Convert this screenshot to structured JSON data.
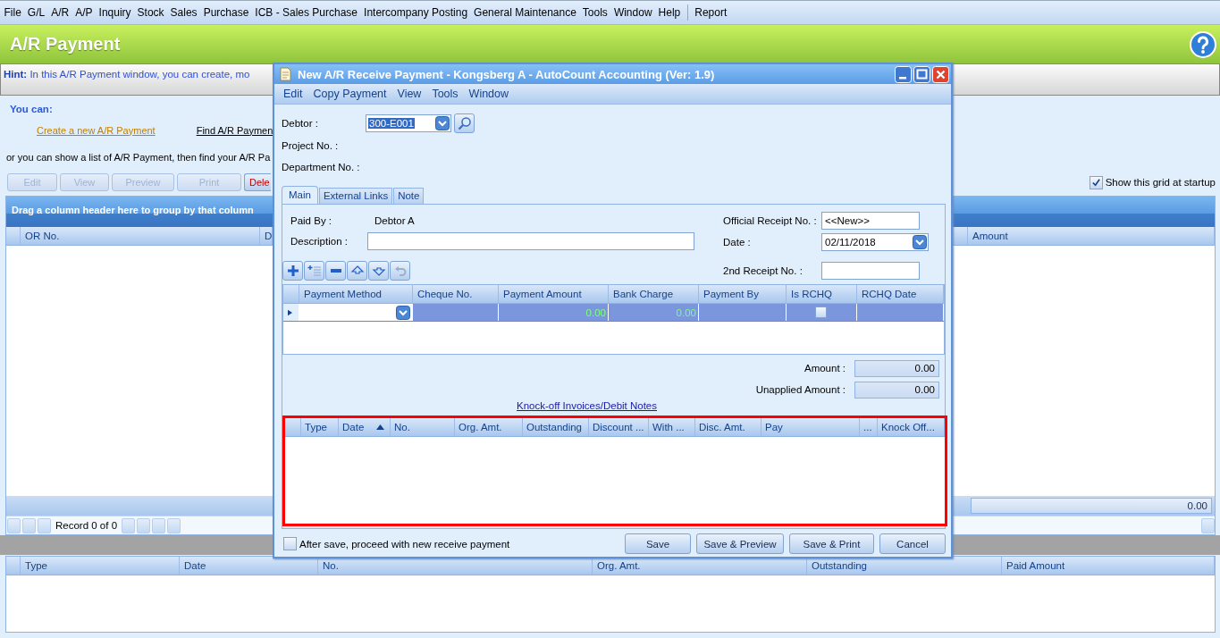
{
  "menu_bar": {
    "items": [
      "File",
      "G/L",
      "A/R",
      "A/P",
      "Inquiry",
      "Stock",
      "Sales",
      "Purchase",
      "ICB - Sales Purchase",
      "Intercompany Posting",
      "General Maintenance",
      "Tools",
      "Window",
      "Help"
    ],
    "extra_items": [
      "Report"
    ]
  },
  "page_header": {
    "title": "A/R Payment"
  },
  "hint": {
    "label": "Hint:",
    "text": "In this A/R Payment window, you can create, mo"
  },
  "actions": {
    "heading": "You can:",
    "links": [
      "Create a new A/R Payment",
      "Find A/R Paymen"
    ],
    "list_text": "or you can show a list of A/R Payment, then find your A/R Pa"
  },
  "toolbar": {
    "buttons": [
      {
        "label": "Edit",
        "disabled": true
      },
      {
        "label": "View",
        "disabled": true
      },
      {
        "label": "Preview",
        "disabled": true
      },
      {
        "label": "Print",
        "disabled": true
      },
      {
        "label": "Dele",
        "disabled": false
      }
    ]
  },
  "show_grid_checkbox": {
    "label": "Show this grid at startup",
    "checked": true
  },
  "list_grid": {
    "group_hint": "Drag a column header here to group by that column",
    "columns": [
      "OR No.",
      "D",
      "Amount"
    ],
    "total": "0.00"
  },
  "navigator": {
    "text": "Record 0 of 0"
  },
  "detail_grid": {
    "columns": [
      "Type",
      "Date",
      "No.",
      "Org. Amt.",
      "Outstanding",
      "Paid Amount"
    ]
  },
  "dialog": {
    "title": "New A/R Receive Payment - Kongsberg A - AutoCount Accounting (Ver: 1.9)",
    "menu": [
      "Edit",
      "Copy Payment",
      "View",
      "Tools",
      "Window"
    ],
    "debtor": {
      "label": "Debtor :",
      "value": "300-E001"
    },
    "project_label": "Project No. :",
    "department_label": "Department No. :",
    "tabs": [
      {
        "label": "Main",
        "selected": true
      },
      {
        "label": "External Links",
        "selected": false
      },
      {
        "label": "Note",
        "selected": false
      }
    ],
    "paid_by": {
      "label": "Paid By :",
      "value": "Debtor A"
    },
    "description": {
      "label": "Description :"
    },
    "official_receipt": {
      "label": "Official Receipt No. :",
      "value": "<<New>>"
    },
    "date": {
      "label": "Date :",
      "value": "02/11/2018"
    },
    "second_receipt": {
      "label": "2nd Receipt No. :"
    },
    "payment_grid": {
      "columns": [
        "Payment Method",
        "Cheque No.",
        "Payment Amount",
        "Bank Charge",
        "Payment By",
        "Is RCHQ",
        "RCHQ Date"
      ],
      "rows": [
        {
          "selected": true,
          "payment_amount": "0.00",
          "bank_charge": "0.00",
          "is_rchq": false
        }
      ]
    },
    "amount": {
      "label": "Amount :",
      "value": "0.00"
    },
    "unapplied": {
      "label": "Unapplied Amount :",
      "value": "0.00"
    },
    "knockoff_link": "Knock-off Invoices/Debit Notes",
    "knockoff_grid": {
      "highlighted": true,
      "columns": [
        {
          "label": "Type",
          "sorted": false
        },
        {
          "label": "Date",
          "sorted": true
        },
        {
          "label": "No.",
          "sorted": false
        },
        {
          "label": "Org. Amt.",
          "sorted": false
        },
        {
          "label": "Outstanding",
          "sorted": false
        },
        {
          "label": "Discount ...",
          "sorted": false
        },
        {
          "label": "With ...",
          "sorted": false
        },
        {
          "label": "Disc. Amt.",
          "sorted": false
        },
        {
          "label": "Pay",
          "sorted": false
        },
        {
          "label": "...",
          "sorted": false
        },
        {
          "label": "Knock Off...",
          "sorted": false
        }
      ]
    },
    "after_save": {
      "label": "After save, proceed with new receive payment",
      "checked": false
    },
    "buttons": [
      "Save",
      "Save & Preview",
      "Save & Print",
      "Cancel"
    ]
  }
}
